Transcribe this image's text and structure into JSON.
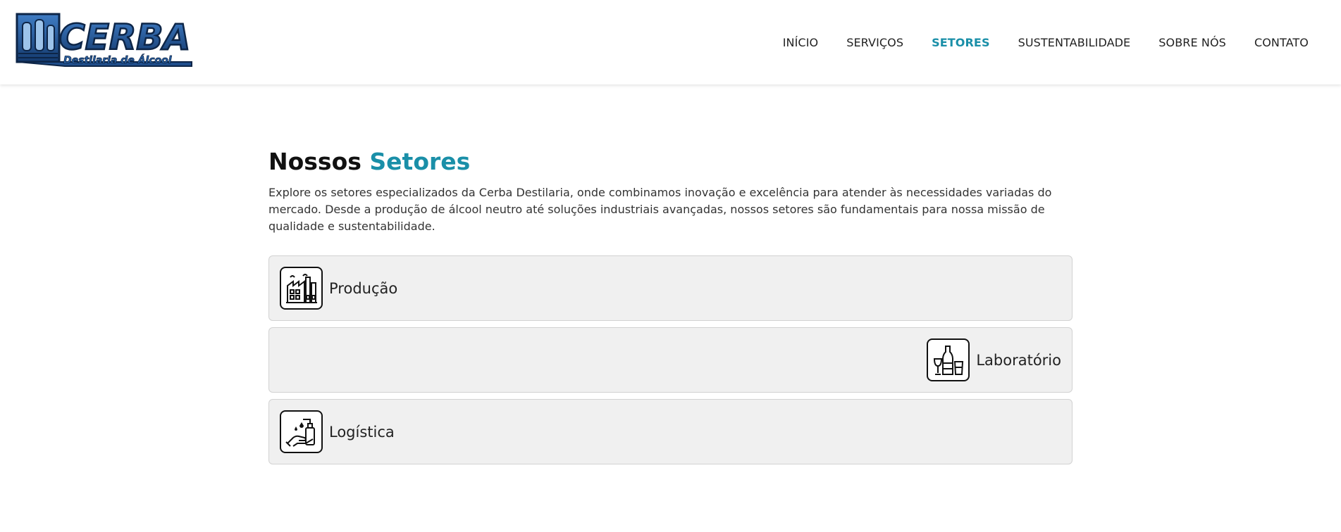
{
  "logo": {
    "brand": "CERBA",
    "tagline": "Destilaria de Álcool"
  },
  "nav": {
    "items": [
      {
        "label": "INÍCIO",
        "active": false
      },
      {
        "label": "SERVIÇOS",
        "active": false
      },
      {
        "label": "SETORES",
        "active": true
      },
      {
        "label": "SUSTENTABILIDADE",
        "active": false
      },
      {
        "label": "SOBRE NÓS",
        "active": false
      },
      {
        "label": "CONTATO",
        "active": false
      }
    ]
  },
  "main": {
    "title_part1": "Nossos",
    "title_part2": "Setores",
    "description": "Explore os setores especializados da Cerba Destilaria, onde combinamos inovação e excelência para atender às necessidades variadas do mercado. Desde a produção de álcool neutro até soluções industriais avançadas, nossos setores são fundamentais para nossa missão de qualidade e sustentabilidade."
  },
  "sectors": [
    {
      "label": "Produção",
      "icon": "factory-icon"
    },
    {
      "label": "Laboratório",
      "icon": "bottles-icon"
    },
    {
      "label": "Logística",
      "icon": "hand-sanitizer-icon"
    }
  ],
  "colors": {
    "accent": "#1a8fa8",
    "logo_blue": "#1f4e8c",
    "card_bg": "#f0f0f0"
  }
}
